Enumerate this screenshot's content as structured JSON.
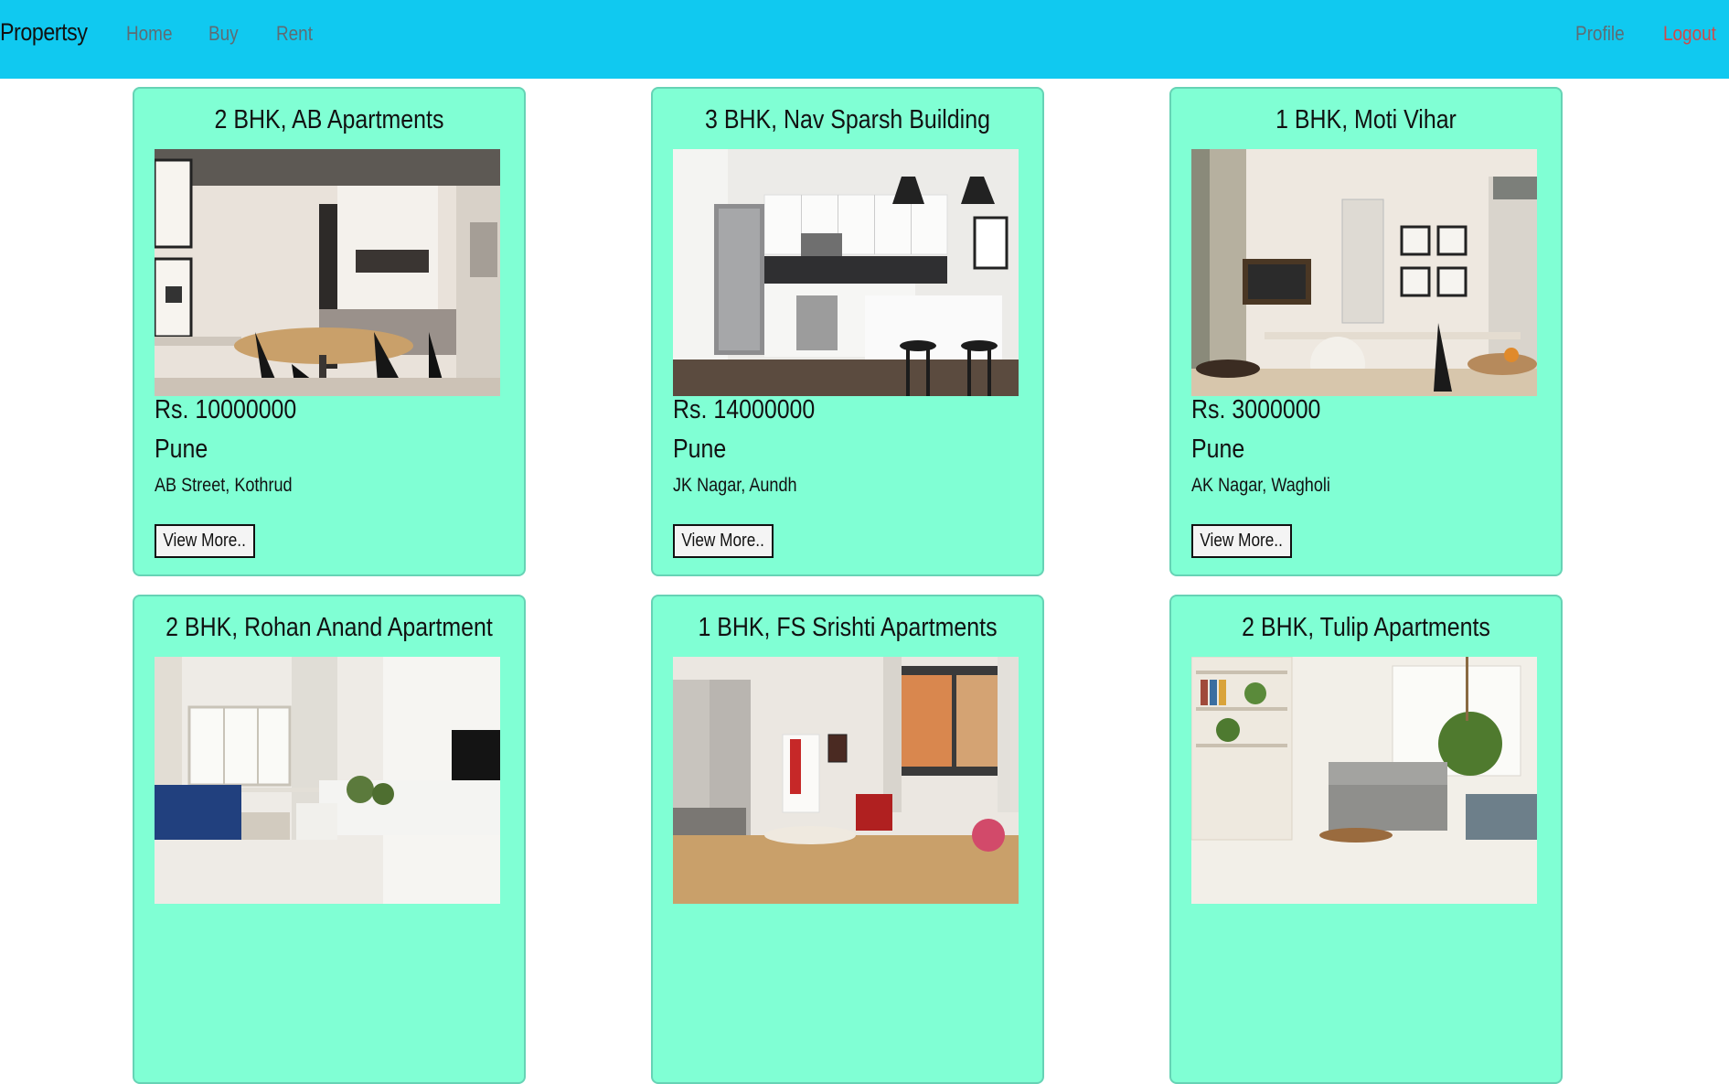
{
  "navbar": {
    "brand": "Propertsy",
    "links": [
      {
        "label": "Home"
      },
      {
        "label": "Buy"
      },
      {
        "label": "Rent"
      }
    ],
    "profile_label": "Profile",
    "logout_label": "Logout"
  },
  "listings": [
    {
      "title": "2 BHK, AB Apartments",
      "price": "Rs. 10000000",
      "city": "Pune",
      "address": "AB Street, Kothrud",
      "button_label": "View More.."
    },
    {
      "title": "3 BHK, Nav Sparsh Building",
      "price": "Rs. 14000000",
      "city": "Pune",
      "address": "JK Nagar, Aundh",
      "button_label": "View More.."
    },
    {
      "title": "1 BHK, Moti Vihar",
      "price": "Rs. 3000000",
      "city": "Pune",
      "address": "AK Nagar, Wagholi",
      "button_label": "View More.."
    },
    {
      "title": "2 BHK, Rohan Anand Apartment"
    },
    {
      "title": "1 BHK, FS Srishti Apartments"
    },
    {
      "title": "2 BHK, Tulip Apartments"
    }
  ],
  "colors": {
    "navbar_bg": "#10c9f0",
    "card_bg": "#80ffd4",
    "logout": "#d04a4a"
  }
}
